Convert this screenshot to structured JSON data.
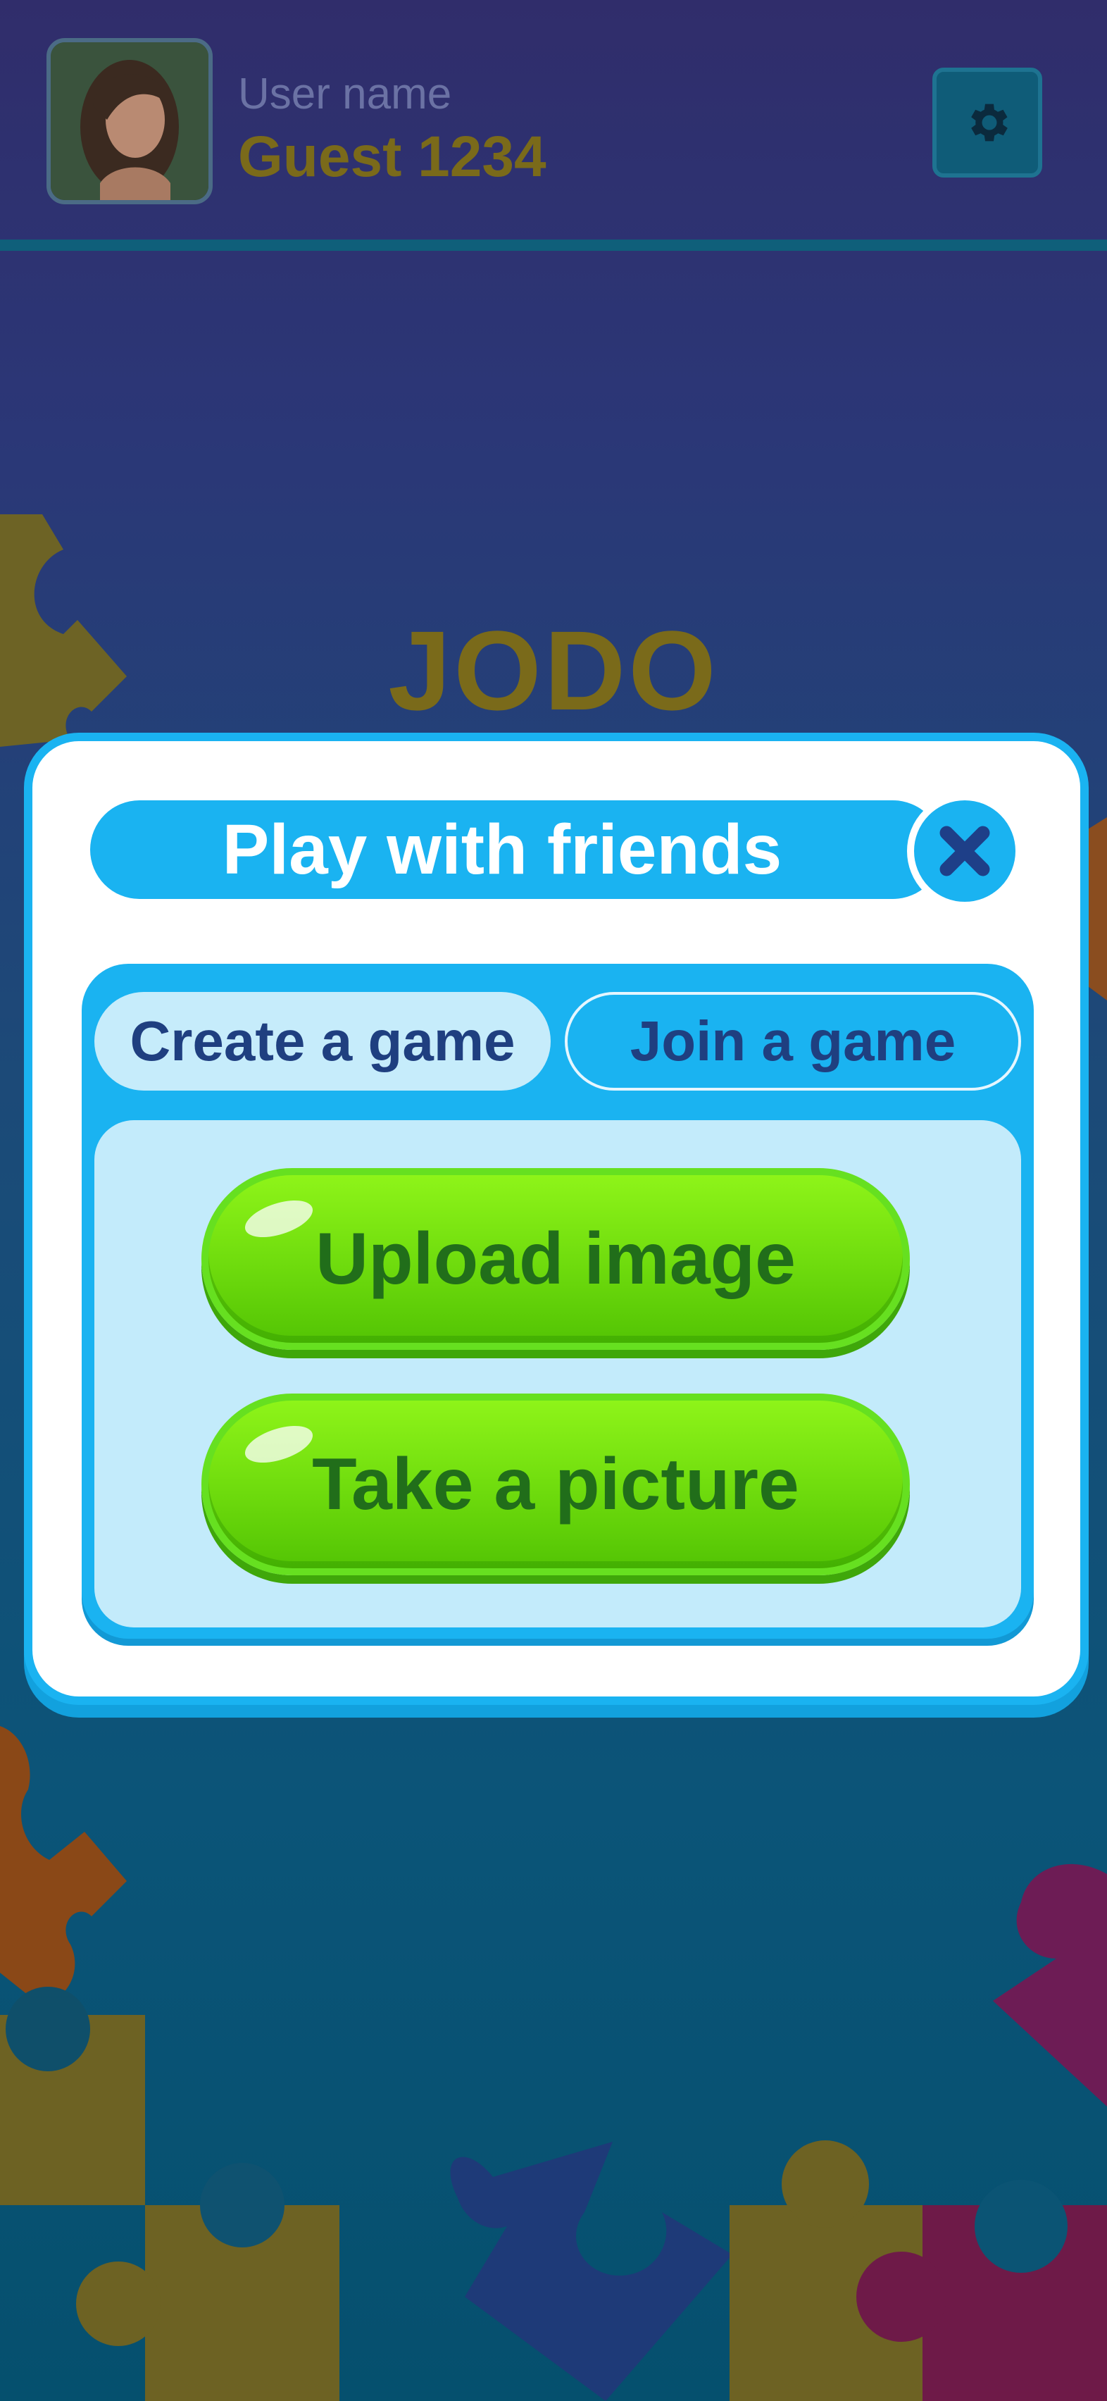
{
  "header": {
    "user_label": "User name",
    "user_name": "Guest 1234",
    "settings_icon": "gear-icon"
  },
  "logo": {
    "text": "JODO"
  },
  "modal": {
    "title": "Play with friends",
    "close_icon": "close-icon",
    "tabs": [
      {
        "label": "Create a game",
        "active": true
      },
      {
        "label": "Join a game",
        "active": false
      }
    ],
    "buttons": {
      "upload_label": "Upload image",
      "picture_label": "Take a picture"
    }
  },
  "colors": {
    "accent_blue": "#1ab3f1",
    "button_green": "#6edb0d",
    "logo_gold": "#7a6a1a",
    "text_dark_blue": "#1f3f80"
  }
}
